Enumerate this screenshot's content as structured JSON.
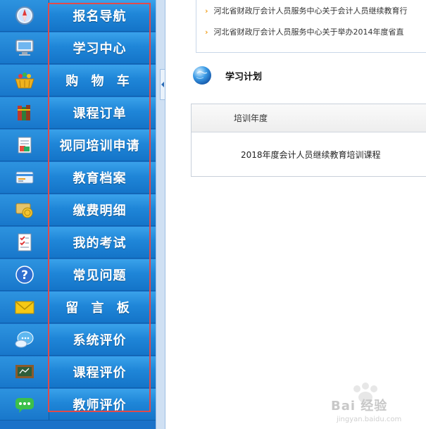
{
  "sidebar": {
    "items": [
      {
        "label": "报名导航",
        "icon": "compass-icon"
      },
      {
        "label": "学习中心",
        "icon": "monitor-icon"
      },
      {
        "label": "购 物 车",
        "icon": "shopping-basket-icon"
      },
      {
        "label": "课程订单",
        "icon": "books-icon"
      },
      {
        "label": "视同培训申请",
        "icon": "application-form-icon"
      },
      {
        "label": "教育档案",
        "icon": "id-card-icon"
      },
      {
        "label": "缴费明细",
        "icon": "coins-icon"
      },
      {
        "label": "我的考试",
        "icon": "checklist-icon"
      },
      {
        "label": "常见问题",
        "icon": "question-icon"
      },
      {
        "label": "留 言 板",
        "icon": "envelope-icon"
      },
      {
        "label": "系统评价",
        "icon": "chat-bubble-icon"
      },
      {
        "label": "课程评价",
        "icon": "chalkboard-icon"
      },
      {
        "label": "教师评价",
        "icon": "speech-dots-icon"
      }
    ]
  },
  "notices": [
    "河北省财政厅会计人员服务中心关于会计人员继续教育行",
    "河北省财政厅会计人员服务中心关于举办2014年度省直"
  ],
  "plan": {
    "title": "学习计划",
    "column_header": "培训年度",
    "row_value": "2018年度会计人员继续教育培训课程"
  },
  "watermark": {
    "brand": "Bai 经验",
    "url": "jingyan.baidu.com"
  },
  "colors": {
    "sidebar_blue": "#1f86d8",
    "highlight_red": "#e24a4a",
    "notice_chevron": "#f0a020"
  }
}
